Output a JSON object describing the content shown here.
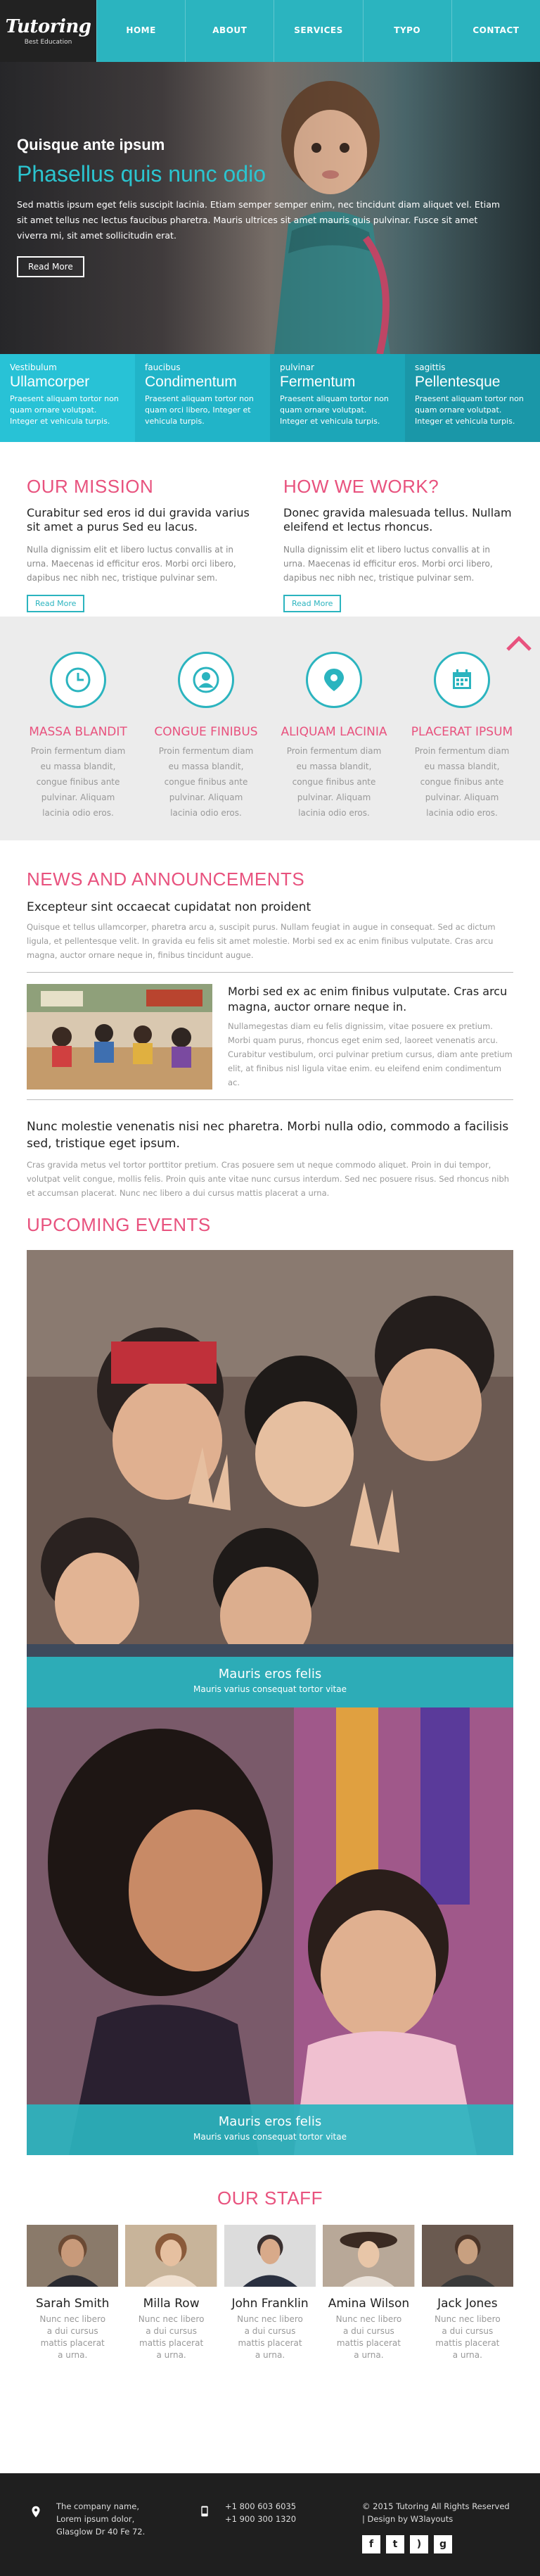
{
  "brand": {
    "title": "Tutoring",
    "subtitle": "Best Education"
  },
  "nav": [
    "HOME",
    "ABOUT",
    "SERVICES",
    "TYPO",
    "CONTACT"
  ],
  "hero": {
    "heading": "Quisque ante ipsum",
    "subheading": "Phasellus quis nunc odio",
    "text": "Sed mattis ipsum eget felis suscipit lacinia. Etiam semper semper enim, nec tincidunt diam aliquet vel. Etiam sit amet tellus nec lectus faucibus pharetra. Mauris ultrices sit amet mauris quis pulvinar. Fusce sit amet viverra mi, sit amet sollicitudin erat.",
    "button": "Read More"
  },
  "strip": [
    {
      "small": "Vestibulum",
      "title": "Ullamcorper",
      "text": "Praesent aliquam tortor non quam ornare volutpat. Integer et vehicula turpis.",
      "color": "#28c2d6"
    },
    {
      "small": "faucibus",
      "title": "Condimentum",
      "text": "Praesent aliquam tortor non quam orci libero, Integer et vehicula turpis.",
      "color": "#21b4c8"
    },
    {
      "small": "pulvinar",
      "title": "Fermentum",
      "text": "Praesent aliquam tortor non quam ornare volutpat. Integer et vehicula turpis.",
      "color": "#1ca6b8"
    },
    {
      "small": "sagittis",
      "title": "Pellentesque",
      "text": "Praesent aliquam tortor non quam ornare volutpat. Integer et vehicula turpis.",
      "color": "#1a97a8"
    }
  ],
  "mission": {
    "title": "OUR MISSION",
    "lead": "Curabitur sed eros id dui gravida varius sit amet a purus Sed eu lacus.",
    "text": "Nulla dignissim elit et libero luctus convallis at in urna. Maecenas id efficitur eros. Morbi orci libero, dapibus nec nibh nec, tristique pulvinar sem.",
    "button": "Read More"
  },
  "how": {
    "title": "HOW WE WORK?",
    "lead": "Donec gravida malesuada tellus. Nullam eleifend et lectus rhoncus.",
    "text": "Nulla dignissim elit et libero luctus convallis at in urna. Maecenas id efficitur eros. Morbi orci libero, dapibus nec nibh nec, tristique pulvinar sem.",
    "button": "Read More"
  },
  "services": [
    {
      "title": "MASSA BLANDIT",
      "text": "Proin fermentum diam eu massa blandit, congue finibus ante pulvinar. Aliquam lacinia odio eros.",
      "icon": "clock-icon"
    },
    {
      "title": "CONGUE FINIBUS",
      "text": "Proin fermentum diam eu massa blandit, congue finibus ante pulvinar. Aliquam lacinia odio eros.",
      "icon": "user-icon"
    },
    {
      "title": "ALIQUAM LACINIA",
      "text": "Proin fermentum diam eu massa blandit, congue finibus ante pulvinar. Aliquam lacinia odio eros.",
      "icon": "map-marker-icon"
    },
    {
      "title": "PLACERAT IPSUM",
      "text": "Proin fermentum diam eu massa blandit, congue finibus ante pulvinar. Aliquam lacinia odio eros.",
      "icon": "calendar-icon"
    }
  ],
  "news": {
    "title": "NEWS AND ANNOUNCEMENTS",
    "lead": "Excepteur sint occaecat cupidatat non proident",
    "text": "Quisque et tellus ullamcorper, pharetra arcu a, suscipit purus. Nullam feugiat in augue in consequat. Sed ac dictum ligula, et pellentesque velit. In gravida eu felis sit amet molestie. Morbi sed ex ac enim finibus vulputate. Cras arcu magna, auctor ornare neque in, finibus tincidunt augue.",
    "item_heading": "Morbi sed ex ac enim finibus vulputate. Cras arcu magna, auctor ornare neque in.",
    "item_text": "Nullamegestas diam eu felis dignissim, vitae posuere ex pretium. Morbi quam purus, rhoncus eget enim sed, laoreet venenatis arcu. Curabitur vestibulum, orci pulvinar pretium cursus, diam ante pretium elit, at finibus nisl ligula vitae enim. eu eleifend enim condimentum ac.",
    "lead2": "Nunc molestie venenatis nisi nec pharetra. Morbi nulla odio, commodo a facilisis sed, tristique eget ipsum.",
    "text2": "Cras gravida metus vel tortor porttitor pretium. Cras posuere sem ut neque commodo aliquet. Proin in dui tempor, volutpat velit congue, mollis felis. Proin quis ante vitae nunc cursus interdum. Sed nec posuere risus. Sed rhoncus nibh et accumsan placerat. Nunc nec libero a dui cursus mattis placerat a urna."
  },
  "events": {
    "title": "UPCOMING EVENTS",
    "items": [
      {
        "title": "Mauris eros felis",
        "subtitle": "Mauris varius consequat tortor vitae"
      },
      {
        "title": "Mauris eros felis",
        "subtitle": "Mauris varius consequat tortor vitae"
      }
    ]
  },
  "staff": {
    "title": "OUR STAFF",
    "members": [
      {
        "name": "Sarah Smith",
        "text": "Nunc nec libero a dui cursus mattis placerat a urna."
      },
      {
        "name": "Milla Row",
        "text": "Nunc nec libero a dui cursus mattis placerat a urna."
      },
      {
        "name": "John Franklin",
        "text": "Nunc nec libero a dui cursus mattis placerat a urna."
      },
      {
        "name": "Amina Wilson",
        "text": "Nunc nec libero a dui cursus mattis placerat a urna."
      },
      {
        "name": "Jack Jones",
        "text": "Nunc nec libero a dui cursus mattis placerat a urna."
      }
    ]
  },
  "footer": {
    "address": [
      "The company name,",
      "Lorem ipsum dolor,",
      "Glasglow Dr 40 Fe 72."
    ],
    "phones": [
      "+1 800 603 6035",
      "+1 900 300 1320"
    ],
    "copyright": [
      "© 2015 Tutoring All Rights Reserved",
      "| Design by W3layouts"
    ],
    "social": [
      "f",
      "t",
      "rss",
      "g+"
    ]
  },
  "colors": {
    "teal": "#2bb4bf",
    "pink": "#e8527e",
    "dark": "#1f1f1f"
  }
}
